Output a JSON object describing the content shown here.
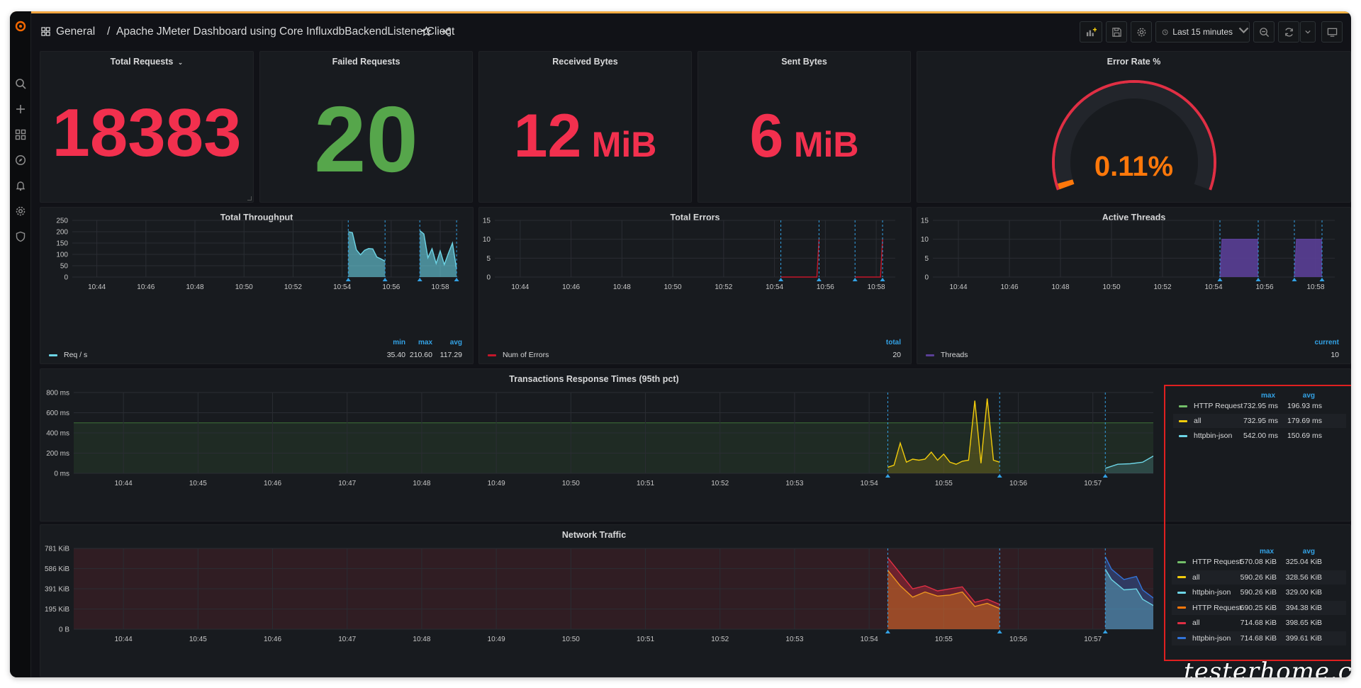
{
  "breadcrumb": {
    "folder": "General",
    "separator": "/",
    "dashboard": "Apache JMeter Dashboard using Core InfluxdbBackendListenerClient"
  },
  "toolbar": {
    "time_range": "Last 15 minutes"
  },
  "colors": {
    "background": "#111217",
    "panel": "#181b1f",
    "accent": "#33a2e5",
    "red": "#f2304e",
    "green": "#56a64b",
    "orange": "#ff780a",
    "purple": "#5a3f96",
    "teal": "#6dd5e6"
  },
  "stats": {
    "total_requests": {
      "title": "Total Requests",
      "value": "18383",
      "color": "#f2304e"
    },
    "failed_requests": {
      "title": "Failed Requests",
      "value": "20",
      "color": "#56a64b"
    },
    "received_bytes": {
      "title": "Received Bytes",
      "value": "12",
      "unit": "MiB",
      "color": "#f2304e"
    },
    "sent_bytes": {
      "title": "Sent Bytes",
      "value": "6",
      "unit": "MiB",
      "color": "#f2304e"
    },
    "error_rate": {
      "title": "Error Rate %",
      "value": "0.11%",
      "fraction": 0.0011,
      "color": "#ff780a"
    }
  },
  "panels": {
    "throughput": {
      "title": "Total Throughput",
      "legend_headers": [
        "min",
        "max",
        "avg"
      ],
      "legend": [
        {
          "name": "Req / s",
          "color": "#6dd5e6",
          "values": [
            "35.40",
            "210.60",
            "117.29"
          ]
        }
      ]
    },
    "errors": {
      "title": "Total Errors",
      "legend_headers": [
        "total"
      ],
      "legend": [
        {
          "name": "Num of Errors",
          "color": "#c4162a",
          "values": [
            "20"
          ]
        }
      ]
    },
    "threads": {
      "title": "Active Threads",
      "legend_headers": [
        "current"
      ],
      "legend": [
        {
          "name": "Threads",
          "color": "#5a3f96",
          "values": [
            "10"
          ]
        }
      ]
    },
    "response": {
      "title": "Transactions Response Times (95th pct)",
      "legend_headers": [
        "max",
        "avg"
      ],
      "legend": [
        {
          "name": "HTTP Request",
          "color": "#73bf69",
          "values": [
            "732.95 ms",
            "196.93 ms"
          ]
        },
        {
          "name": "all",
          "color": "#f2cc0c",
          "values": [
            "732.95 ms",
            "179.69 ms"
          ]
        },
        {
          "name": "httpbin-json",
          "color": "#6dd5e6",
          "values": [
            "542.00 ms",
            "150.69 ms"
          ]
        }
      ]
    },
    "network": {
      "title": "Network Traffic",
      "legend_headers": [
        "max",
        "avg"
      ],
      "legend": [
        {
          "name": "HTTP Request",
          "color": "#73bf69",
          "values": [
            "570.08 KiB",
            "325.04 KiB"
          ]
        },
        {
          "name": "all",
          "color": "#f2cc0c",
          "values": [
            "590.26 KiB",
            "328.56 KiB"
          ]
        },
        {
          "name": "httpbin-json",
          "color": "#6dd5e6",
          "values": [
            "590.26 KiB",
            "329.00 KiB"
          ]
        },
        {
          "name": "HTTP Request",
          "color": "#ff780a",
          "values": [
            "690.25 KiB",
            "394.38 KiB"
          ]
        },
        {
          "name": "all",
          "color": "#e02f44",
          "values": [
            "714.68 KiB",
            "398.65 KiB"
          ]
        },
        {
          "name": "httpbin-json",
          "color": "#3274d9",
          "values": [
            "714.68 KiB",
            "399.61 KiB"
          ]
        }
      ]
    }
  },
  "chart_data": [
    {
      "type": "area",
      "title": "Total Throughput",
      "x_ticks": [
        "10:44",
        "10:46",
        "10:48",
        "10:50",
        "10:52",
        "10:54",
        "10:56",
        "10:58"
      ],
      "y_ticks": [
        "0",
        "50",
        "100",
        "150",
        "200",
        "250"
      ],
      "xlim": [
        "10:43",
        "10:58:45"
      ],
      "ylim": [
        0,
        250
      ],
      "annotations": [
        "10:54:15",
        "10:55:45",
        "10:57:10",
        "10:58:40"
      ],
      "series": [
        {
          "name": "Req / s",
          "color": "#6dd5e6",
          "segments": [
            {
              "x": [
                "10:54:15",
                "10:54:25",
                "10:54:35",
                "10:54:45",
                "10:54:55",
                "10:55:05",
                "10:55:15",
                "10:55:25",
                "10:55:35",
                "10:55:45"
              ],
              "y": [
                200,
                196,
                120,
                98,
                118,
                126,
                124,
                88,
                80,
                70
              ]
            },
            {
              "x": [
                "10:57:10",
                "10:57:20",
                "10:57:30",
                "10:57:40",
                "10:57:50",
                "10:58:00",
                "10:58:10",
                "10:58:20",
                "10:58:30",
                "10:58:40"
              ],
              "y": [
                205,
                190,
                85,
                125,
                60,
                115,
                55,
                105,
                150,
                35
              ]
            }
          ]
        }
      ]
    },
    {
      "type": "line",
      "title": "Total Errors",
      "x_ticks": [
        "10:44",
        "10:46",
        "10:48",
        "10:50",
        "10:52",
        "10:54",
        "10:56",
        "10:58"
      ],
      "y_ticks": [
        "0",
        "5",
        "10",
        "15"
      ],
      "xlim": [
        "10:43",
        "10:58:45"
      ],
      "ylim": [
        0,
        15
      ],
      "annotations": [
        "10:54:15",
        "10:55:45",
        "10:57:10",
        "10:58:15"
      ],
      "series": [
        {
          "name": "Num of Errors",
          "color": "#c4162a",
          "segments": [
            {
              "x": [
                "10:54:15",
                "10:55:40",
                "10:55:45"
              ],
              "y": [
                0,
                0,
                10
              ]
            },
            {
              "x": [
                "10:57:10",
                "10:58:10",
                "10:58:15"
              ],
              "y": [
                0,
                0,
                10
              ]
            }
          ]
        }
      ]
    },
    {
      "type": "area",
      "title": "Active Threads",
      "x_ticks": [
        "10:44",
        "10:46",
        "10:48",
        "10:50",
        "10:52",
        "10:54",
        "10:56",
        "10:58"
      ],
      "y_ticks": [
        "0",
        "5",
        "10",
        "15"
      ],
      "xlim": [
        "10:43",
        "10:58:45"
      ],
      "ylim": [
        0,
        15
      ],
      "annotations": [
        "10:54:15",
        "10:55:45",
        "10:57:10",
        "10:58:15"
      ],
      "series": [
        {
          "name": "Threads",
          "color": "#5a3f96",
          "segments": [
            {
              "x": [
                "10:54:15",
                "10:54:20",
                "10:55:45"
              ],
              "y": [
                0,
                10,
                10
              ]
            },
            {
              "x": [
                "10:57:10",
                "10:57:15",
                "10:58:15"
              ],
              "y": [
                0,
                10,
                10
              ]
            }
          ]
        }
      ]
    },
    {
      "type": "line",
      "title": "Transactions Response Times (95th pct)",
      "x_ticks": [
        "10:44",
        "10:45",
        "10:46",
        "10:47",
        "10:48",
        "10:49",
        "10:50",
        "10:51",
        "10:52",
        "10:53",
        "10:54",
        "10:55",
        "10:56",
        "10:57",
        "10:58"
      ],
      "y_ticks": [
        "0 ms",
        "200 ms",
        "400 ms",
        "600 ms",
        "800 ms"
      ],
      "xlim": [
        "10:43:20",
        "10:58:20"
      ],
      "ylim": [
        0,
        800
      ],
      "thresholds": [
        {
          "value": 500,
          "color": "#56a64b"
        }
      ],
      "annotations": [
        "10:54:15",
        "10:55:45",
        "10:57:10",
        "10:58:15"
      ],
      "series": [
        {
          "name": "all",
          "color": "#f2cc0c",
          "segments": [
            {
              "x": [
                "10:54:15",
                "10:54:20",
                "10:54:25",
                "10:54:30",
                "10:54:35",
                "10:54:40",
                "10:54:45",
                "10:54:50",
                "10:54:55",
                "10:55:00",
                "10:55:05",
                "10:55:10",
                "10:55:15",
                "10:55:20",
                "10:55:25",
                "10:55:30",
                "10:55:35",
                "10:55:40",
                "10:55:45"
              ],
              "y": [
                60,
                80,
                300,
                110,
                140,
                130,
                140,
                210,
                130,
                190,
                110,
                90,
                120,
                130,
                720,
                100,
                740,
                130,
                110
              ]
            }
          ]
        },
        {
          "name": "httpbin-json",
          "color": "#6dd5e6",
          "segments": [
            {
              "x": [
                "10:57:10",
                "10:57:20",
                "10:57:30",
                "10:57:40",
                "10:57:50",
                "10:58:00",
                "10:58:05",
                "10:58:10",
                "10:58:15"
              ],
              "y": [
                50,
                90,
                95,
                110,
                180,
                540,
                100,
                110,
                250
              ]
            }
          ]
        }
      ]
    },
    {
      "type": "area",
      "title": "Network Traffic",
      "x_ticks": [
        "10:44",
        "10:45",
        "10:46",
        "10:47",
        "10:48",
        "10:49",
        "10:50",
        "10:51",
        "10:52",
        "10:53",
        "10:54",
        "10:55",
        "10:56",
        "10:57",
        "10:58"
      ],
      "y_ticks": [
        "0 B",
        "195 KiB",
        "391 KiB",
        "586 KiB",
        "781 KiB"
      ],
      "xlim": [
        "10:43:20",
        "10:58:20"
      ],
      "ylim": [
        0,
        781
      ],
      "thresholds": [
        {
          "value": 781,
          "color": "#e02f44"
        }
      ],
      "annotations": [
        "10:54:15",
        "10:55:45",
        "10:57:10",
        "10:58:15"
      ],
      "series": [
        {
          "name": "all",
          "color": "#f2cc0c",
          "segments": [
            {
              "x": [
                "10:54:15",
                "10:54:25",
                "10:54:35",
                "10:54:45",
                "10:54:55",
                "10:55:05",
                "10:55:15",
                "10:55:25",
                "10:55:35",
                "10:55:45"
              ],
              "y": [
                570,
                420,
                310,
                360,
                320,
                330,
                360,
                220,
                250,
                200
              ]
            }
          ]
        },
        {
          "name": "all",
          "color": "#e02f44",
          "segments": [
            {
              "x": [
                "10:54:15",
                "10:54:25",
                "10:54:35",
                "10:54:45",
                "10:54:55",
                "10:55:05",
                "10:55:15",
                "10:55:25",
                "10:55:35",
                "10:55:45"
              ],
              "y": [
                690,
                540,
                390,
                420,
                370,
                390,
                410,
                260,
                290,
                240
              ]
            }
          ]
        },
        {
          "name": "httpbin-json",
          "color": "#3274d9",
          "segments": [
            {
              "x": [
                "10:57:10",
                "10:57:15",
                "10:57:25",
                "10:57:35",
                "10:57:40",
                "10:57:50",
                "10:58:00",
                "10:58:05",
                "10:58:15"
              ],
              "y": [
                700,
                580,
                480,
                510,
                380,
                290,
                460,
                390,
                420
              ]
            }
          ]
        },
        {
          "name": "httpbin-json",
          "color": "#6dd5e6",
          "segments": [
            {
              "x": [
                "10:57:10",
                "10:57:15",
                "10:57:25",
                "10:57:35",
                "10:57:40",
                "10:57:50",
                "10:58:00",
                "10:58:05",
                "10:58:15"
              ],
              "y": [
                580,
                480,
                380,
                390,
                290,
                220,
                380,
                290,
                330
              ]
            }
          ]
        }
      ]
    }
  ],
  "watermark": "testerhome.com"
}
